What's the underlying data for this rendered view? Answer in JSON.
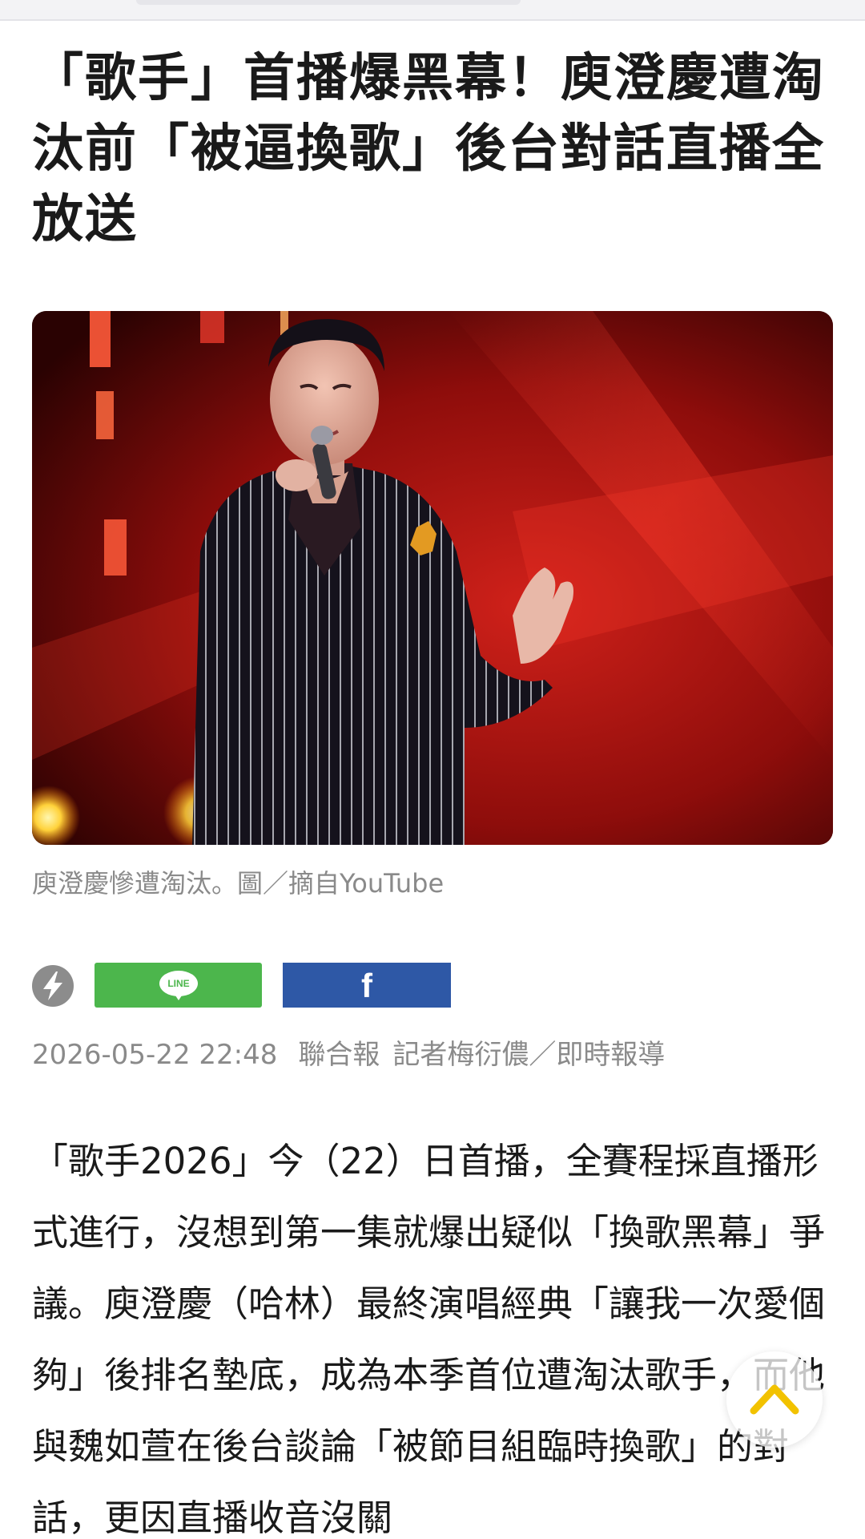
{
  "article": {
    "headline": "「歌手」首播爆黑幕！庾澄慶遭淘汰前「被逼換歌」後台對話直播全放送",
    "image_caption": "庾澄慶慘遭淘汰。圖／摘自YouTube",
    "share": {
      "line_label": "LINE",
      "facebook_label": "f"
    },
    "meta": {
      "datetime": "2026-05-22 22:48",
      "source": "聯合報",
      "byline": "記者梅衍儂／即時報導"
    },
    "body": "「歌手2026」今（22）日首播，全賽程採直播形式進行，沒想到第一集就爆出疑似「換歌黑幕」爭議。庾澄慶（哈林）最終演唱經典「讓我一次愛個夠」後排名墊底，成為本季首位遭淘汰歌手，而他與魏如萱在後台談論「被節目組臨時換歌」的對話，更因直播收音沒關"
  },
  "colors": {
    "line_green": "#4cb64c",
    "facebook_blue": "#2e58a6",
    "meta_gray": "#8a8a8a",
    "scroll_arrow": "#f2c200"
  },
  "icons": {
    "share_primary": "lightning-bolt-icon",
    "scroll_top": "chevron-up-icon"
  }
}
